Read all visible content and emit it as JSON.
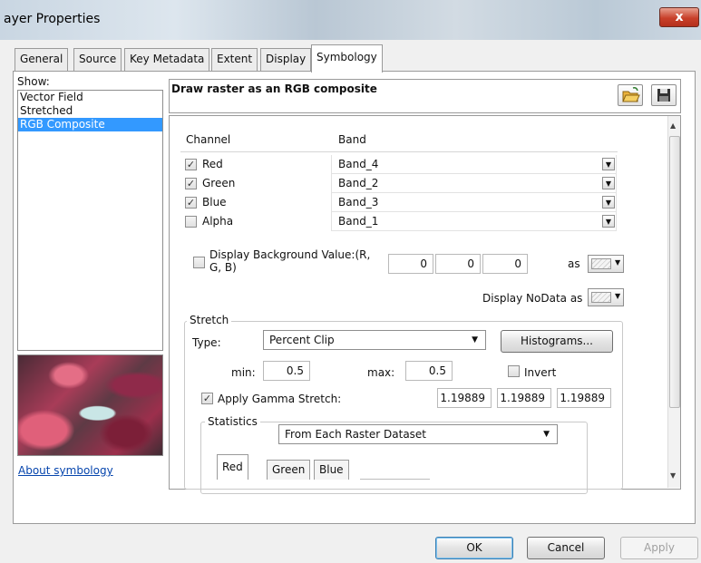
{
  "window": {
    "title": "ayer Properties",
    "close": "x"
  },
  "tabs": [
    {
      "label": "General"
    },
    {
      "label": "Source"
    },
    {
      "label": "Key Metadata"
    },
    {
      "label": "Extent"
    },
    {
      "label": "Display"
    },
    {
      "label": "Symbology"
    }
  ],
  "active_tab": "Symbology",
  "show": {
    "label": "Show:",
    "items": [
      {
        "label": "Vector Field"
      },
      {
        "label": "Stretched"
      },
      {
        "label": "RGB Composite"
      }
    ],
    "selected": "RGB Composite"
  },
  "about_link": "About symbology",
  "main": {
    "heading": "Draw raster as an RGB composite",
    "icons": [
      "open-folder-icon",
      "save-icon"
    ],
    "channel_table": {
      "headers": {
        "channel": "Channel",
        "band": "Band"
      },
      "rows": [
        {
          "channel": "Red",
          "band": "Band_4",
          "checked": true
        },
        {
          "channel": "Green",
          "band": "Band_2",
          "checked": true
        },
        {
          "channel": "Blue",
          "band": "Band_3",
          "checked": true
        },
        {
          "channel": "Alpha",
          "band": "Band_1",
          "checked": false
        }
      ]
    },
    "background": {
      "label": "Display Background Value:(R,\nG, B)",
      "checked": false,
      "r": "0",
      "g": "0",
      "b": "0",
      "as_label": "as"
    },
    "nodata": {
      "label": "Display NoData as"
    },
    "stretch": {
      "group_label": "Stretch",
      "type_label": "Type:",
      "type_value": "Percent Clip",
      "histograms_button": "Histograms...",
      "min_label": "min:",
      "min_value": "0.5",
      "max_label": "max:",
      "max_value": "0.5",
      "invert_label": "Invert",
      "invert_checked": false,
      "gamma_label": "Apply Gamma Stretch:",
      "gamma_checked": true,
      "gamma_values": [
        "1.19889",
        "1.19889",
        "1.19889"
      ]
    },
    "statistics": {
      "group_label": "Statistics",
      "value": "From Each Raster Dataset",
      "tabs": [
        "Red",
        "Green",
        "Blue"
      ],
      "active_tab": "Red"
    }
  },
  "buttons": {
    "ok": "OK",
    "cancel": "Cancel",
    "apply": "Apply"
  },
  "colors": {
    "selection": "#3399ff",
    "link": "#0645ad",
    "close": "#c8402a"
  }
}
